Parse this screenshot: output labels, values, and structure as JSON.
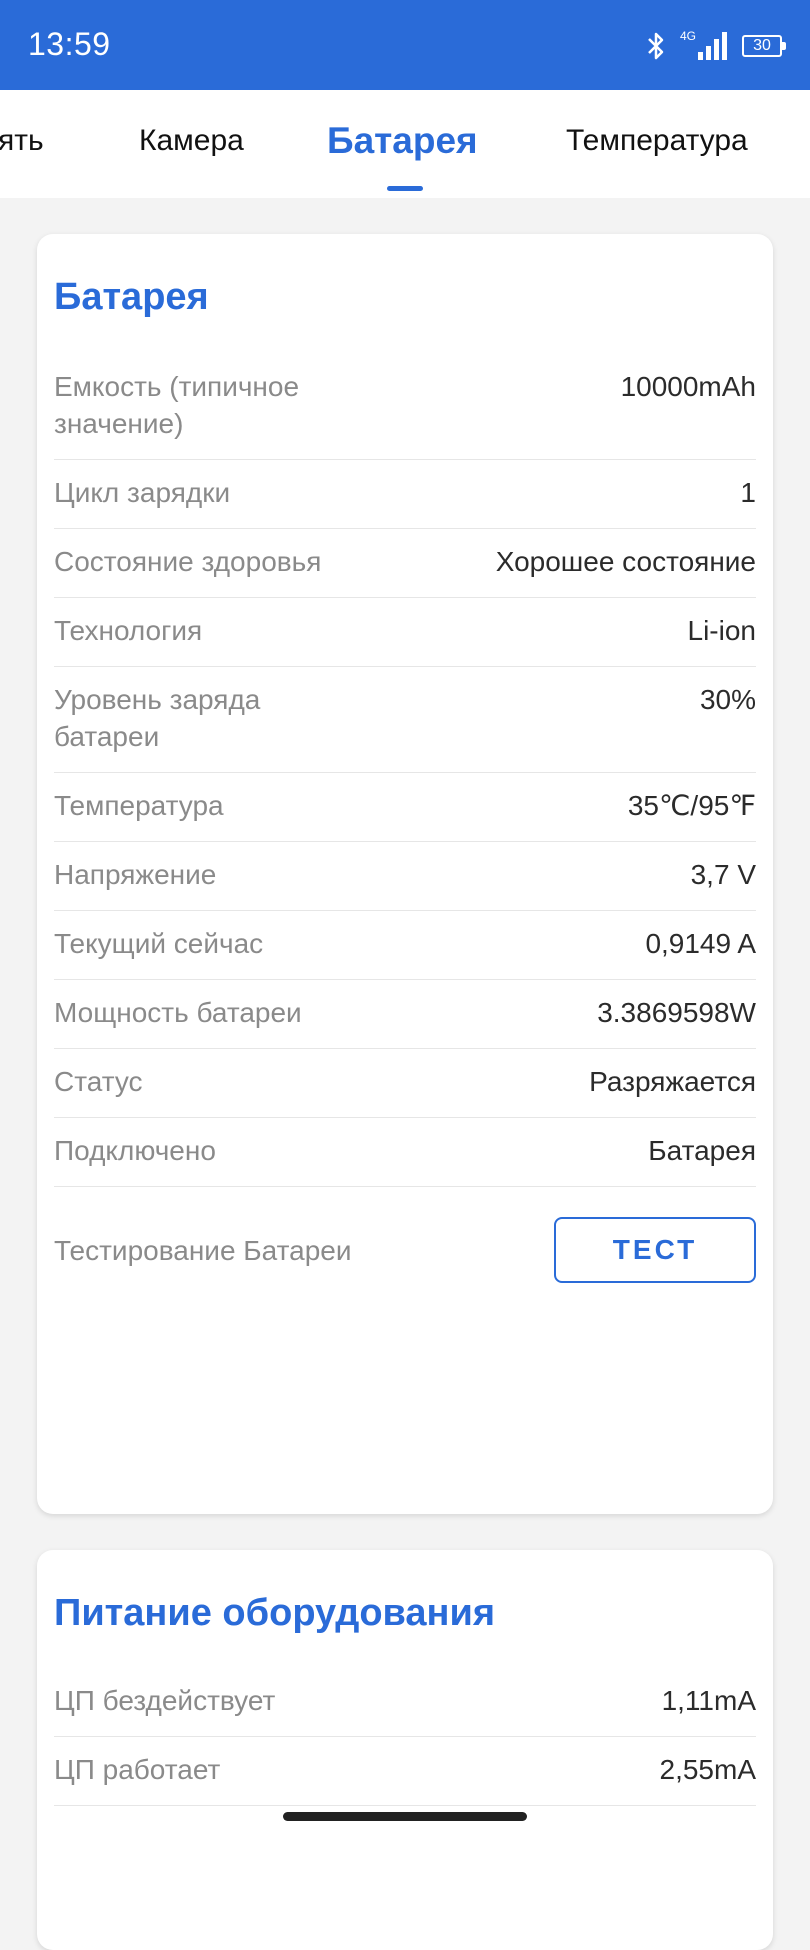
{
  "status_bar": {
    "time": "13:59",
    "network": "4G",
    "battery_level": "30",
    "icons": [
      "bluetooth-icon",
      "signal-icon",
      "battery-icon"
    ]
  },
  "tabs": [
    {
      "label": "ять",
      "active": false
    },
    {
      "label": "Камера",
      "active": false
    },
    {
      "label": "Батарея",
      "active": true
    },
    {
      "label": "Температура",
      "active": false
    }
  ],
  "battery_card": {
    "title": "Батарея",
    "rows": [
      {
        "label": "Емкость (типичное значение)",
        "value": "10000mAh"
      },
      {
        "label": "Цикл зарядки",
        "value": "1"
      },
      {
        "label": "Состояние здоровья",
        "value": "Хорошее состояние"
      },
      {
        "label": "Технология",
        "value": "Li-ion"
      },
      {
        "label": "Уровень заряда батареи",
        "value": "30%"
      },
      {
        "label": "Температура",
        "value": "35℃/95℉"
      },
      {
        "label": "Напряжение",
        "value": "3,7 V"
      },
      {
        "label": "Текущий сейчас",
        "value": "0,9149 A"
      },
      {
        "label": "Мощность батареи",
        "value": "3.3869598W"
      },
      {
        "label": "Статус",
        "value": "Разряжается"
      },
      {
        "label": "Подключено",
        "value": "Батарея"
      }
    ],
    "test_label": "Тестирование Батареи",
    "test_button": "ТЕСТ"
  },
  "hardware_card": {
    "title": "Питание оборудования",
    "rows": [
      {
        "label": "ЦП бездействует",
        "value": "1,11mA"
      },
      {
        "label": "ЦП работает",
        "value": "2,55mA"
      }
    ]
  },
  "colors": {
    "accent": "#2a6bd8",
    "background": "#f3f3f3",
    "label": "#8a8a8a",
    "value": "#2b2b2b"
  }
}
